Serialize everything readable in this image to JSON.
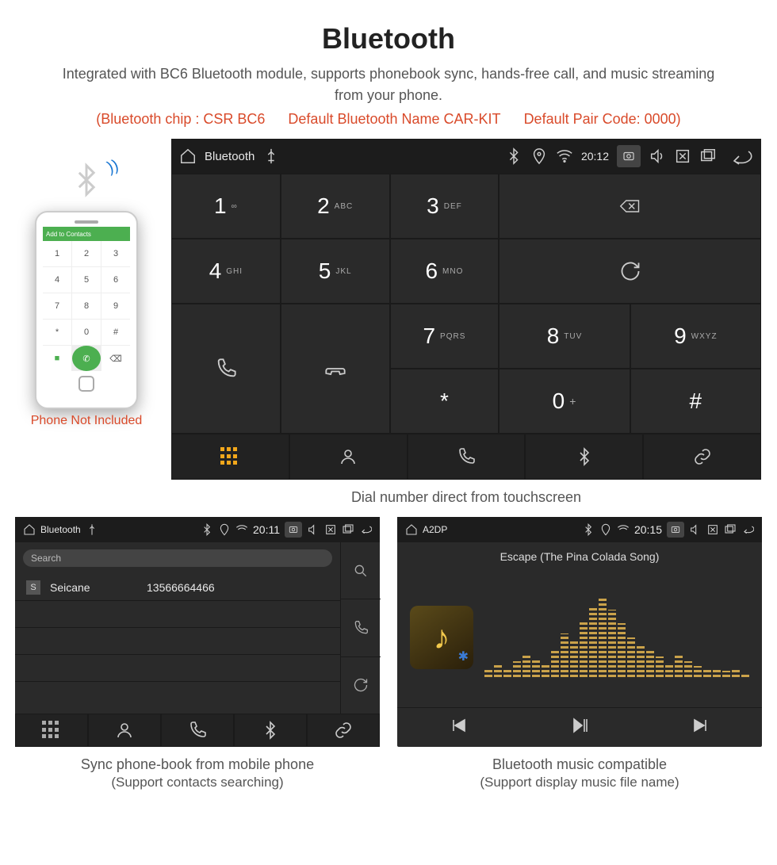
{
  "title": "Bluetooth",
  "desc": "Integrated with BC6 Bluetooth module, supports phonebook sync, hands-free call, and music streaming from your phone.",
  "spec": {
    "chip": "(Bluetooth chip : CSR BC6",
    "name": "Default Bluetooth Name CAR-KIT",
    "code": "Default Pair Code: 0000)"
  },
  "phone": {
    "label": "Phone Not Included",
    "add_text": "Add to Contacts",
    "keys": [
      "1",
      "2",
      "3",
      "4",
      "5",
      "6",
      "7",
      "8",
      "9",
      "*",
      "0",
      "#"
    ]
  },
  "screen1": {
    "title": "Bluetooth",
    "time": "20:12",
    "keys": [
      {
        "n": "1",
        "s": "∞"
      },
      {
        "n": "2",
        "s": "ABC"
      },
      {
        "n": "3",
        "s": "DEF"
      },
      {
        "n": "4",
        "s": "GHI"
      },
      {
        "n": "5",
        "s": "JKL"
      },
      {
        "n": "6",
        "s": "MNO"
      },
      {
        "n": "7",
        "s": "PQRS"
      },
      {
        "n": "8",
        "s": "TUV"
      },
      {
        "n": "9",
        "s": "WXYZ"
      },
      {
        "n": "*",
        "s": ""
      },
      {
        "n": "0",
        "s": "+"
      },
      {
        "n": "#",
        "s": ""
      }
    ],
    "caption": "Dial number direct from touchscreen"
  },
  "screen2": {
    "title": "Bluetooth",
    "time": "20:11",
    "search": "Search",
    "contact_init": "S",
    "contact_name": "Seicane",
    "contact_number": "13566664466",
    "caption": "Sync phone-book from mobile phone",
    "caption_sub": "(Support contacts searching)"
  },
  "screen3": {
    "title": "A2DP",
    "time": "20:15",
    "song": "Escape (The Pina Colada Song)",
    "caption": "Bluetooth music compatible",
    "caption_sub": "(Support display music file name)"
  }
}
